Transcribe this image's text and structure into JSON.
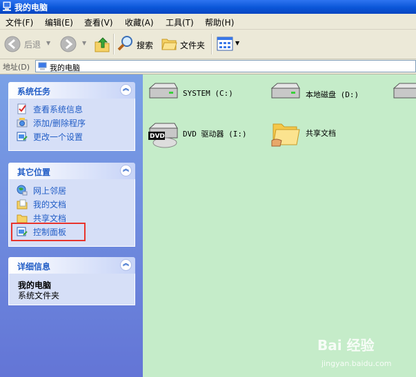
{
  "window": {
    "title": "我的电脑"
  },
  "menu": {
    "items": [
      "文件(F)",
      "编辑(E)",
      "查看(V)",
      "收藏(A)",
      "工具(T)",
      "帮助(H)"
    ]
  },
  "toolbar": {
    "back_label": "后退",
    "search_label": "搜索",
    "folders_label": "文件夹"
  },
  "address": {
    "label": "地址(D)",
    "value": "我的电脑"
  },
  "sidebar": {
    "system_tasks": {
      "title": "系统任务",
      "items": [
        {
          "label": "查看系统信息",
          "icon": "system-info-icon"
        },
        {
          "label": "添加/删除程序",
          "icon": "add-remove-programs-icon"
        },
        {
          "label": "更改一个设置",
          "icon": "change-setting-icon"
        }
      ]
    },
    "other_places": {
      "title": "其它位置",
      "items": [
        {
          "label": "网上邻居",
          "icon": "network-places-icon"
        },
        {
          "label": "我的文档",
          "icon": "my-documents-icon"
        },
        {
          "label": "共享文档",
          "icon": "shared-documents-icon"
        },
        {
          "label": "控制面板",
          "icon": "control-panel-icon"
        }
      ]
    },
    "details": {
      "title": "详细信息",
      "name": "我的电脑",
      "type": "系统文件夹"
    }
  },
  "content": {
    "items": [
      {
        "label": "SYSTEM (C:)",
        "icon": "hard-drive-icon"
      },
      {
        "label": "本地磁盘 (D:)",
        "icon": "hard-drive-icon"
      },
      {
        "label": "",
        "icon": "hard-drive-icon"
      },
      {
        "label": "DVD 驱动器 (I:)",
        "icon": "dvd-drive-icon"
      },
      {
        "label": "共享文档",
        "icon": "shared-folder-icon"
      }
    ]
  },
  "watermark": {
    "text": "Bai 经验",
    "sub": "jingyan.baidu.com"
  },
  "colors": {
    "titlebar": "#0a56d8",
    "sidebar": "#6f8fe0",
    "content_bg": "#c5ecc9",
    "link": "#215dc6",
    "highlight": "#e8342c"
  }
}
